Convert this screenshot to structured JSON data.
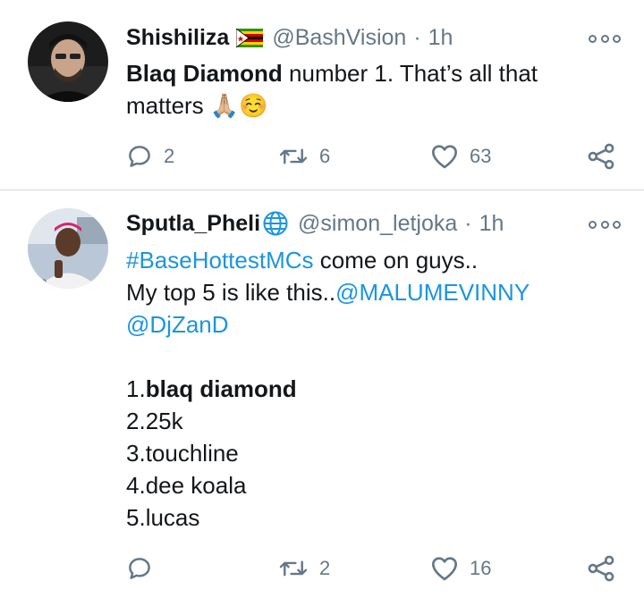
{
  "tweets": [
    {
      "name": "Shishiliza",
      "handle": "@BashVision",
      "separator": "·",
      "time": "1h",
      "badge_icon": "zimbabwe-flag-icon",
      "text_bold": "Blaq Diamond",
      "text_rest": " number 1. That’s all that",
      "text_line2": "matters",
      "emojis": "🙏🏼☺️",
      "replies": "2",
      "retweets": "6",
      "likes": "63"
    },
    {
      "name": "Sputla_Pheli",
      "handle": "@simon_letjoka",
      "separator": "·",
      "time": "1h",
      "badge_icon": "globe-icon",
      "hashtag": "#BaseHottestMCs",
      "line1_rest": " come on guys..",
      "line2_text": "My top 5 is like this..",
      "mention1": "@MALUMEVINNY",
      "mention2": "@DjZanD",
      "list": [
        {
          "num": "1.",
          "text": "blaq diamond",
          "bold": true
        },
        {
          "num": "2.",
          "text": "25k"
        },
        {
          "num": "3.",
          "text": "touchline"
        },
        {
          "num": "4.",
          "text": "dee koala"
        },
        {
          "num": "5.",
          "text": "lucas"
        }
      ],
      "replies": "",
      "retweets": "2",
      "likes": "16"
    }
  ],
  "colors": {
    "text": "#14171a",
    "secondary": "#657786",
    "link": "#1b95e0",
    "divider": "#d6dde3"
  }
}
